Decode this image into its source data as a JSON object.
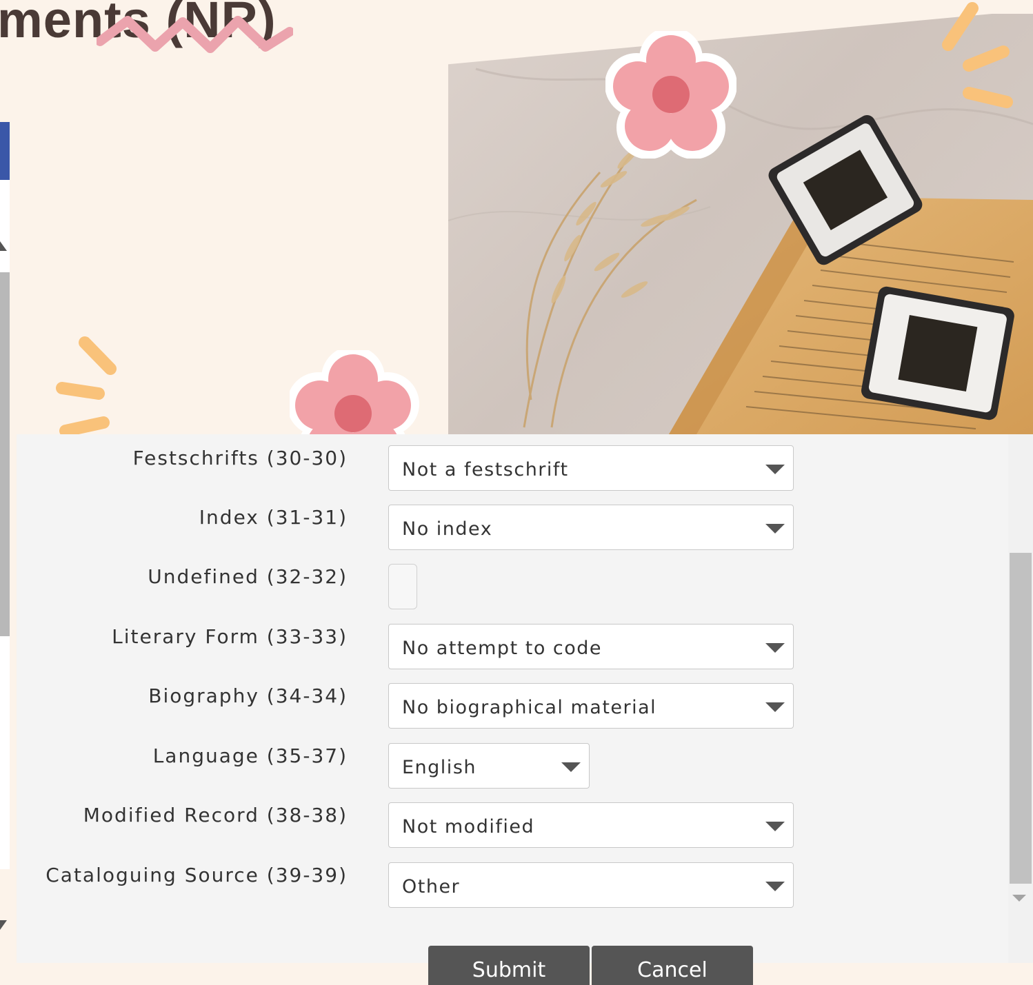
{
  "slide": {
    "title": "ments (NR)"
  },
  "dialog": {
    "fields": [
      {
        "label": "Festschrifts (30-30)",
        "type": "select",
        "value": "Not a festschrift"
      },
      {
        "label": "Index (31-31)",
        "type": "select",
        "value": "No index"
      },
      {
        "label": "Undefined (32-32)",
        "type": "checkbox",
        "value": ""
      },
      {
        "label": "Literary Form (33-33)",
        "type": "select",
        "value": "No attempt to code"
      },
      {
        "label": "Biography (34-34)",
        "type": "select",
        "value": "No biographical material"
      },
      {
        "label": "Language (35-37)",
        "type": "select-narrow",
        "value": "English"
      },
      {
        "label": "Modified Record (38-38)",
        "type": "select",
        "value": "Not modified"
      },
      {
        "label": "Cataloguing Source (39-39)",
        "type": "select",
        "value": "Other"
      }
    ],
    "buttons": {
      "submit": "Submit",
      "cancel": "Cancel"
    }
  },
  "colors": {
    "background": "#fcf3ea",
    "title": "#4a3a36",
    "flower": "#f2a2a8",
    "flower_center": "#de6b74",
    "sparkle": "#f9c27a",
    "zigzag": "#eba3ad",
    "button": "#555555"
  }
}
